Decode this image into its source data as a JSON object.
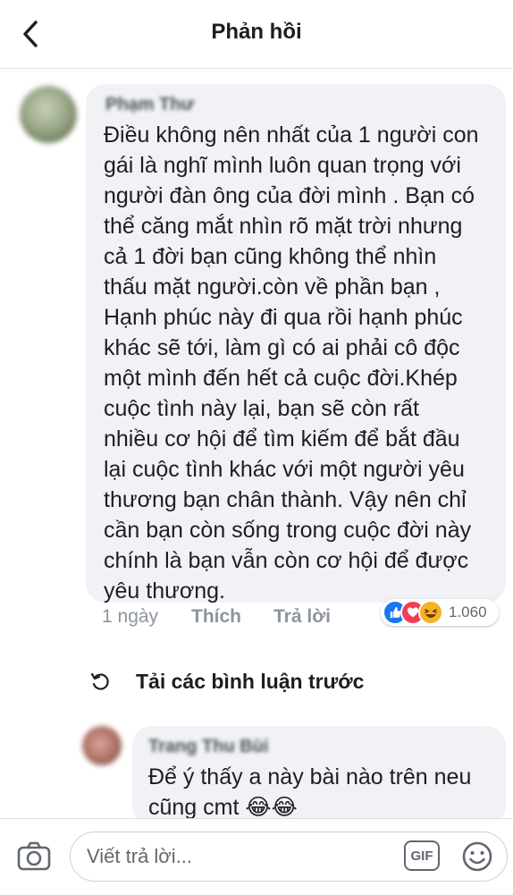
{
  "header": {
    "title": "Phản hồi"
  },
  "comments": [
    {
      "author": "Phạm Thư",
      "text": "Điều không nên nhất của 1 người con\ngái là  nghĩ mình luôn quan trọng với\nngười đàn ông của đời mình . Bạn có\nthể căng mắt nhìn rõ mặt trời  nhưng\ncả 1 đời bạn cũng không thể nhìn\nthấu mặt người.còn về phần bạn ,\nHạnh phúc này đi qua rồi hạnh phúc\nkhác sẽ tới, làm gì có ai phải cô độc\nmột mình đến hết cả cuộc đời.Khép\ncuộc tình này lại, bạn sẽ còn rất\nnhiều cơ hội để tìm kiếm để bắt đầu\nlại cuộc tình khác với một người yêu\nthương bạn chân thành. Vậy nên chỉ\ncần bạn còn sống trong cuộc đời này\nchính là bạn vẫn còn cơ hội để được\nyêu thương.",
      "time": "1 ngày",
      "like_label": "Thích",
      "reply_label": "Trả lời",
      "reactions": [
        "like-icon",
        "love-icon",
        "haha-icon"
      ],
      "reaction_count": "1.060"
    },
    {
      "author": "Trang Thu Bùi",
      "text": "Để ý thấy a này bài nào trên neu\ncũng cmt 😂😂"
    }
  ],
  "load_previous": {
    "label": "Tải các bình luận trước",
    "icon": "refresh-icon"
  },
  "composer": {
    "placeholder": "Viết trả lời...",
    "gif_label": "GIF",
    "camera_icon": "camera-icon",
    "emoji_icon": "emoji-icon"
  },
  "colors": {
    "bubble": "#f0f2f5",
    "like": "#1877f2",
    "love": "#f33e58",
    "haha": "#f7b125",
    "meta_text": "#8d949e"
  }
}
